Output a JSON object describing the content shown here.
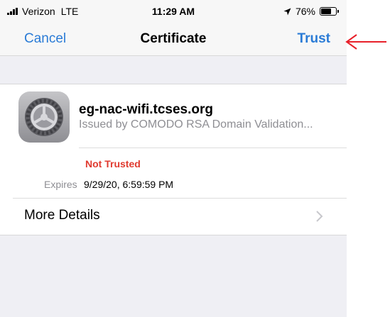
{
  "status_bar": {
    "carrier": "Verizon",
    "network": "LTE",
    "time": "11:29 AM",
    "battery_percent": "76%",
    "battery_level": 0.76
  },
  "nav": {
    "cancel_label": "Cancel",
    "title": "Certificate",
    "trust_label": "Trust"
  },
  "certificate": {
    "name": "eg-nac-wifi.tcses.org",
    "issuer": "Issued by COMODO RSA Domain Validation...",
    "trust_status": "Not Trusted",
    "expires_label": "Expires",
    "expires_value": "9/29/20, 6:59:59 PM"
  },
  "more_details_label": "More Details",
  "colors": {
    "accent": "#2a7bd6",
    "warning": "#e03a2f",
    "annotation_arrow": "#e8202a"
  }
}
